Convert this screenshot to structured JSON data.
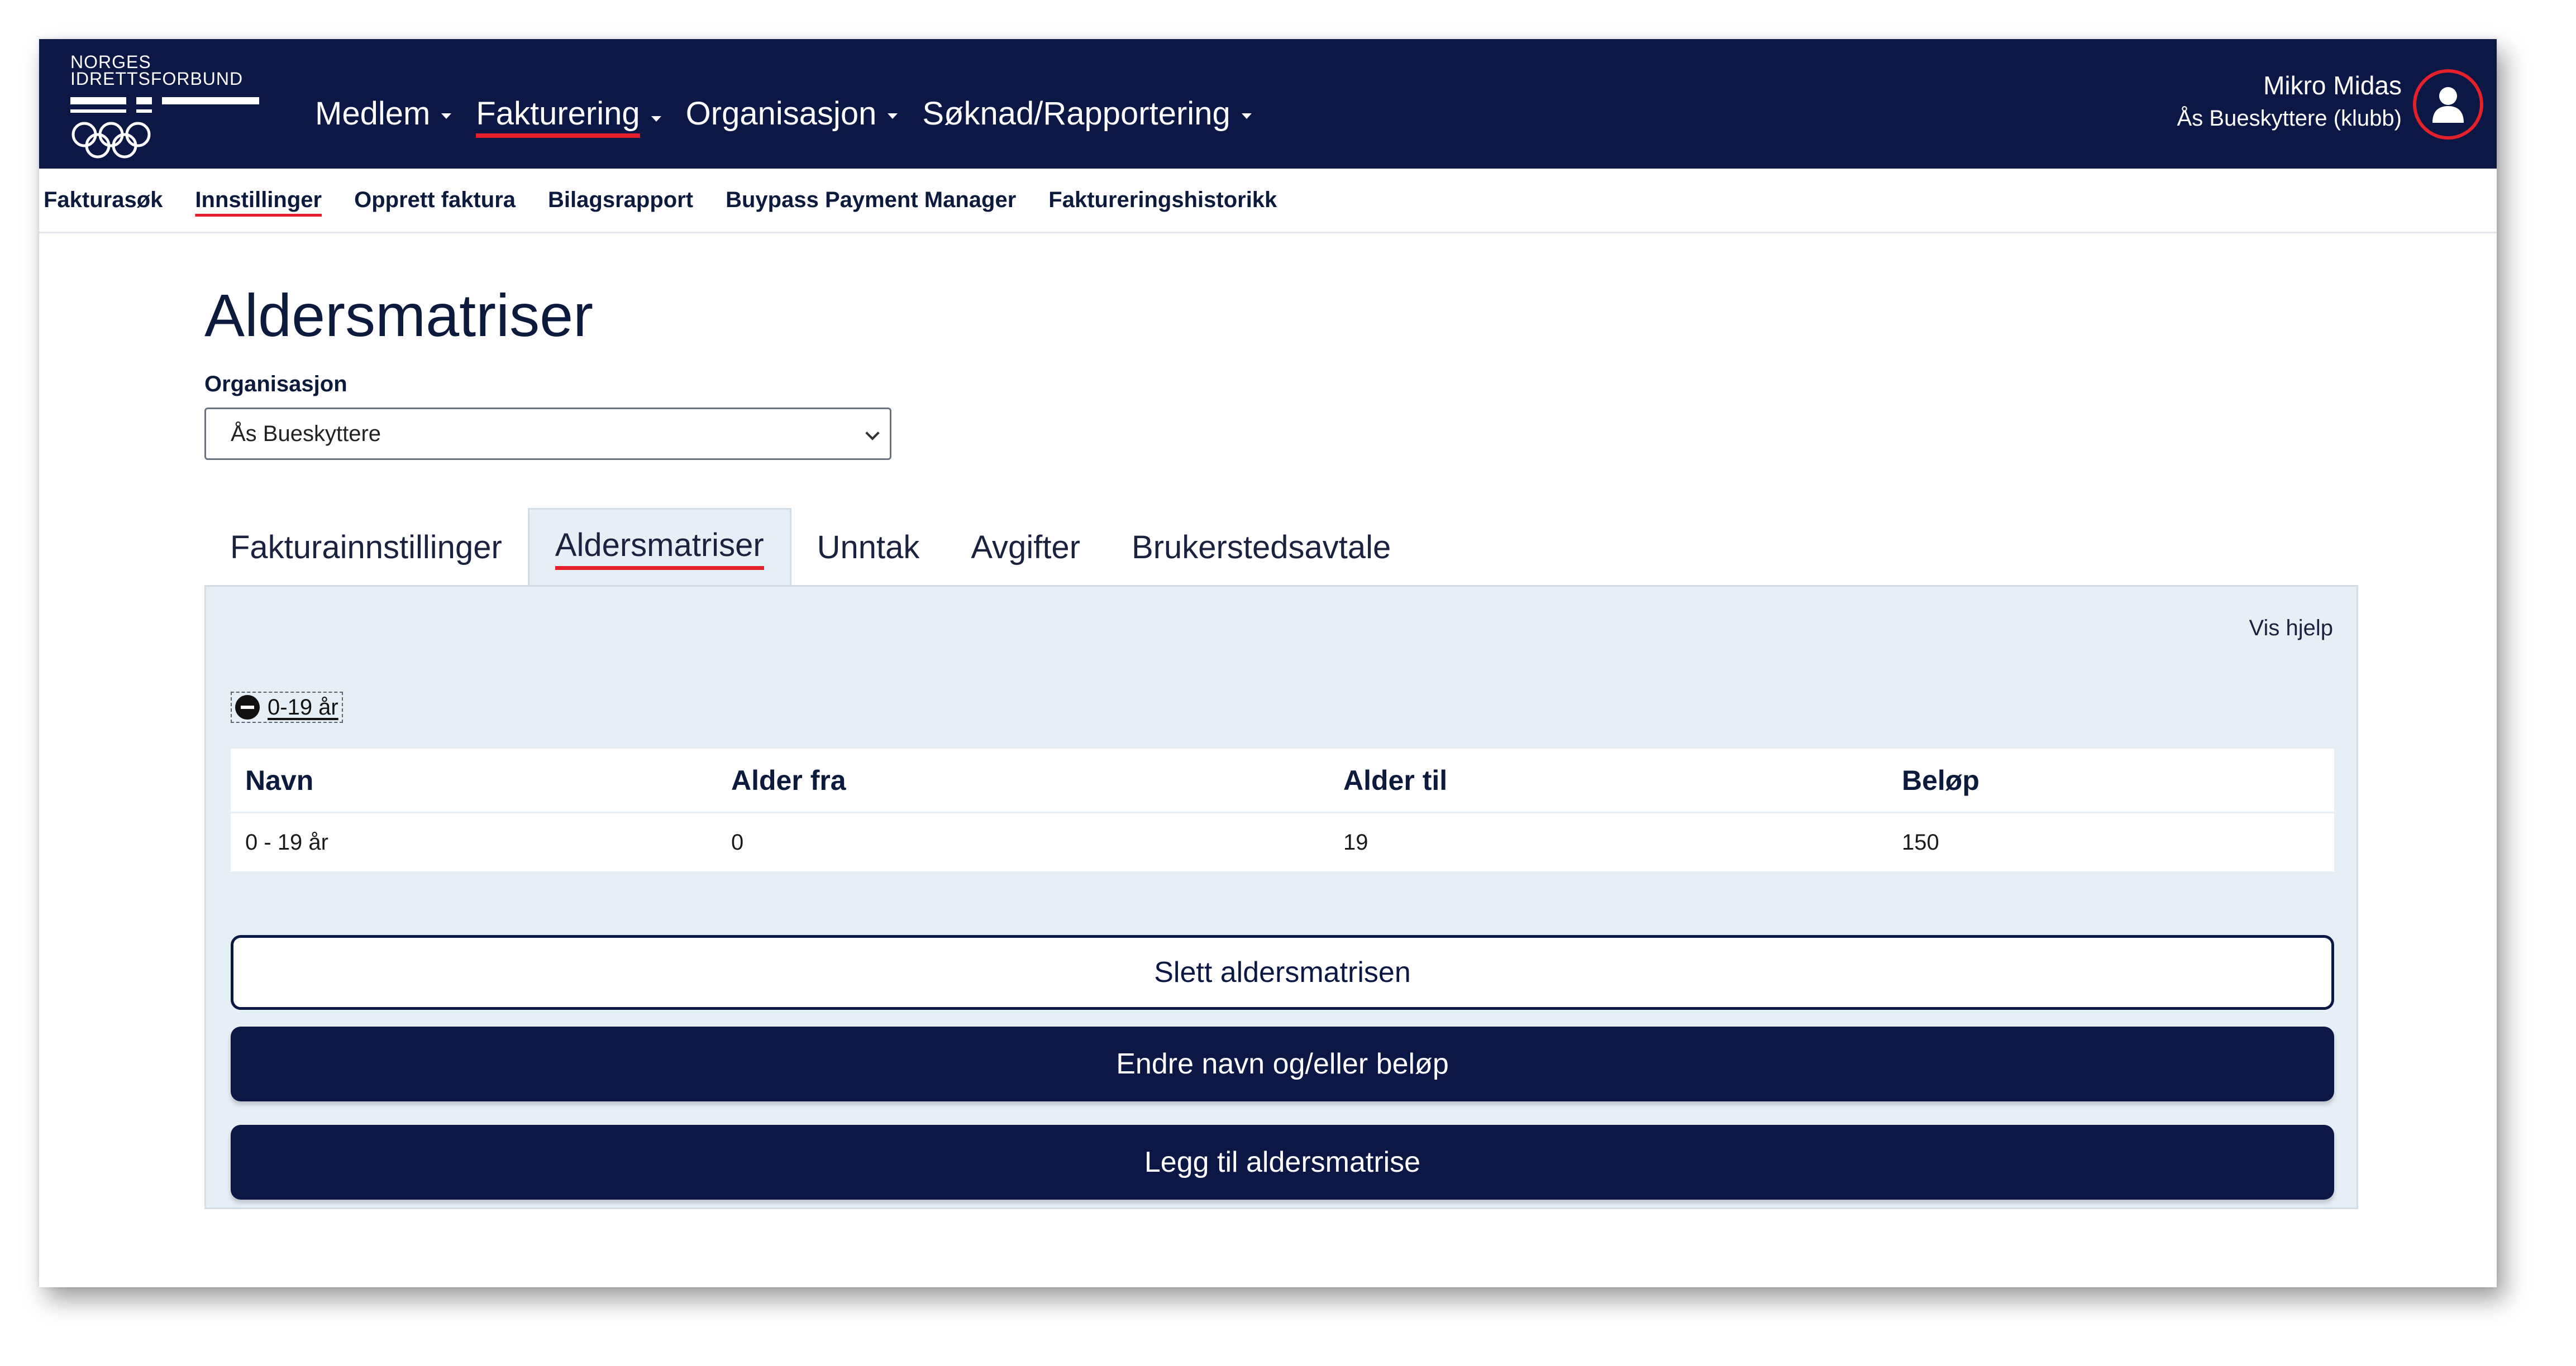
{
  "header": {
    "logo_lines": [
      "NORGES",
      "IDRETTSFORBUND"
    ],
    "nav": [
      {
        "label": "Medlem",
        "active": false
      },
      {
        "label": "Fakturering",
        "active": true
      },
      {
        "label": "Organisasjon",
        "active": false
      },
      {
        "label": "Søknad/Rapportering",
        "active": false
      }
    ],
    "user_name": "Mikro Midas",
    "user_org": "Ås Bueskyttere (klubb)"
  },
  "subnav": [
    {
      "label": "Fakturasøk",
      "active": false
    },
    {
      "label": "Innstillinger",
      "active": true
    },
    {
      "label": "Opprett faktura",
      "active": false
    },
    {
      "label": "Bilagsrapport",
      "active": false
    },
    {
      "label": "Buypass Payment Manager",
      "active": false
    },
    {
      "label": "Faktureringshistorikk",
      "active": false
    }
  ],
  "page": {
    "title": "Aldersmatriser",
    "org_label": "Organisasjon",
    "org_selected": "Ås Bueskyttere"
  },
  "tabs": [
    {
      "label": "Fakturainnstillinger",
      "active": false
    },
    {
      "label": "Aldersmatriser",
      "active": true
    },
    {
      "label": "Unntak",
      "active": false
    },
    {
      "label": "Avgifter",
      "active": false
    },
    {
      "label": "Brukerstedsavtale",
      "active": false
    }
  ],
  "panel": {
    "help_link": "Vis hjelp",
    "matrix_toggle_label": "0-19 år",
    "table": {
      "headers": [
        "Navn",
        "Alder fra",
        "Alder til",
        "Beløp"
      ],
      "rows": [
        [
          "0 - 19 år",
          "0",
          "19",
          "150"
        ]
      ]
    },
    "delete_button": "Slett aldersmatrisen",
    "edit_button": "Endre navn og/eller beløp",
    "add_button": "Legg til aldersmatrise"
  },
  "colors": {
    "header_bg": "#0b1745",
    "accent_red": "#e4202b",
    "panel_bg": "#e6eff5"
  }
}
